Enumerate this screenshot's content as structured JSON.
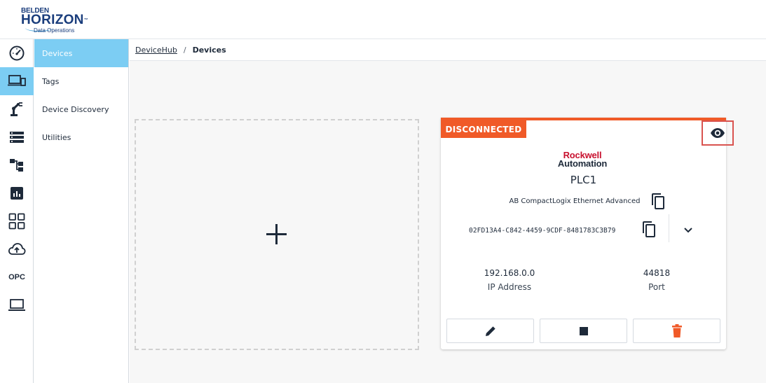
{
  "app": {
    "logo_line1": "BELDEN",
    "logo_line2": "HORIZON",
    "logo_trademark": "™",
    "logo_line3": "Data Operations"
  },
  "rail": {
    "items": [
      {
        "icon": "dashboard-gauge-icon",
        "active": false
      },
      {
        "icon": "devices-icon",
        "active": true
      },
      {
        "icon": "robot-arm-icon",
        "active": false
      },
      {
        "icon": "list-icon",
        "active": false
      },
      {
        "icon": "hierarchy-icon",
        "active": false
      },
      {
        "icon": "analytics-icon",
        "active": false
      },
      {
        "icon": "apps-grid-icon",
        "active": false
      },
      {
        "icon": "cloud-upload-icon",
        "active": false
      },
      {
        "icon": "opc-icon",
        "label": "OPC",
        "active": false
      },
      {
        "icon": "laptop-icon",
        "active": false
      }
    ]
  },
  "subnav": {
    "items": [
      {
        "label": "Devices",
        "active": true
      },
      {
        "label": "Tags",
        "active": false
      },
      {
        "label": "Device Discovery",
        "active": false
      },
      {
        "label": "Utilities",
        "active": false
      }
    ]
  },
  "breadcrumb": {
    "root": "DeviceHub",
    "separator": "/",
    "current": "Devices"
  },
  "device_card": {
    "status": "DISCONNECTED",
    "status_color": "#f05a28",
    "vendor_line1": "Rockwell",
    "vendor_line2": "Automation",
    "name": "PLC1",
    "model": "AB CompactLogix Ethernet Advanced",
    "guid": "02FD13A4-C842-4459-9CDF-8481783C3B79",
    "ip_value": "192.168.0.0",
    "ip_label": "IP Address",
    "port_value": "44818",
    "port_label": "Port"
  },
  "colors": {
    "accent": "#7ccdf3",
    "text": "#1e2a3a",
    "danger": "#f05a28",
    "highlight_border": "#d9534f"
  }
}
